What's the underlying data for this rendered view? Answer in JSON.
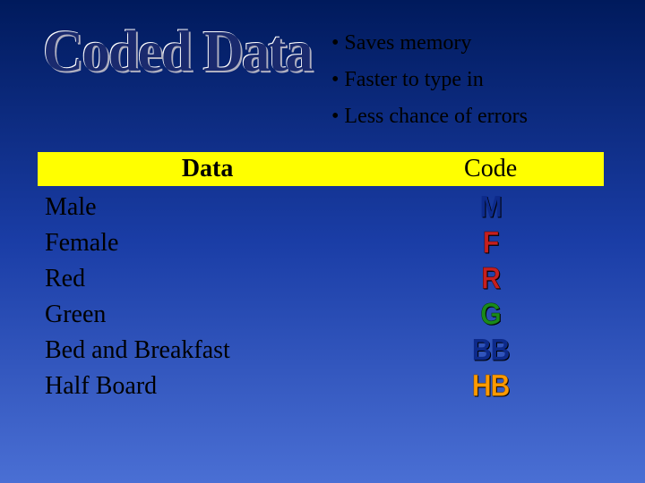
{
  "title": "Coded Data",
  "bullets": [
    "Saves memory",
    "Faster to type in",
    "Less chance of errors"
  ],
  "table": {
    "headers": {
      "data": "Data",
      "code": "Code"
    },
    "rows": [
      {
        "data": "Male",
        "code": "M"
      },
      {
        "data": "Female",
        "code": "F"
      },
      {
        "data": "Red",
        "code": "R"
      },
      {
        "data": "Green",
        "code": "G"
      },
      {
        "data": "Bed and Breakfast",
        "code": "BB"
      },
      {
        "data": "Half Board",
        "code": "HB"
      }
    ]
  }
}
